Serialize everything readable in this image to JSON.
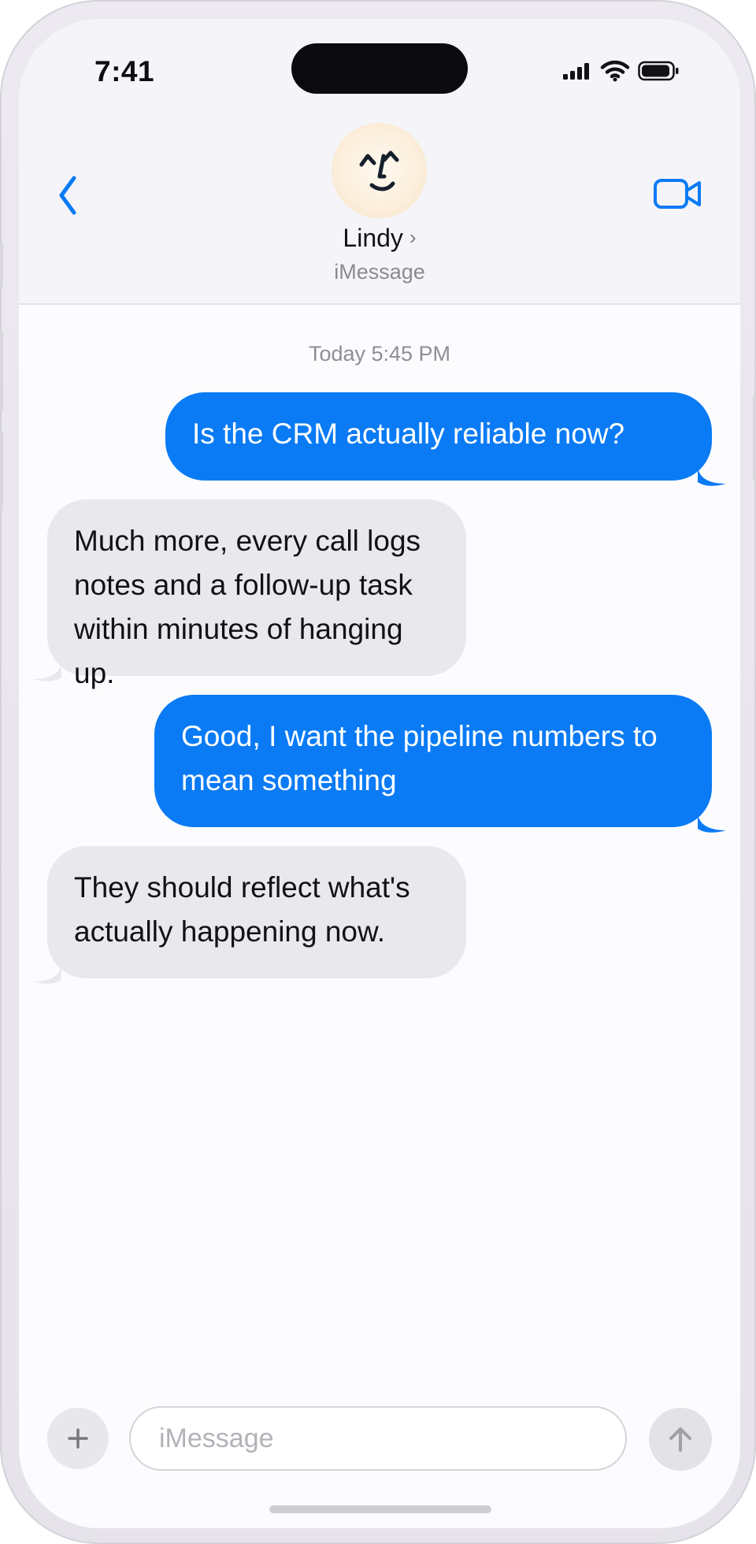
{
  "status_bar": {
    "time": "7:41"
  },
  "header": {
    "contact_name": "Lindy",
    "contact_chevron": "›",
    "subtitle": "iMessage",
    "back_icon": "chevron-left-icon",
    "video_icon": "video-camera-icon",
    "avatar_icon": "lindy-face-icon"
  },
  "conversation": {
    "timestamp": "Today 5:45 PM",
    "messages": [
      {
        "direction": "outgoing",
        "text": "Is the CRM actually reliable now?"
      },
      {
        "direction": "incoming",
        "text": "Much more, every call logs notes and a follow-up task within minutes of hanging up."
      },
      {
        "direction": "outgoing",
        "text": "Good, I want the pipeline numbers to mean something"
      },
      {
        "direction": "incoming",
        "text": "They should reflect what's actually happening now."
      }
    ]
  },
  "composer": {
    "placeholder": "iMessage",
    "value": "",
    "plus_icon": "plus-icon",
    "send_icon": "arrow-up-icon"
  },
  "colors": {
    "accent": "#0a7bf5",
    "incoming_bubble": "#e9e8ed",
    "header_background": "#f5f4f8",
    "screen_background": "#fcfcfe"
  }
}
